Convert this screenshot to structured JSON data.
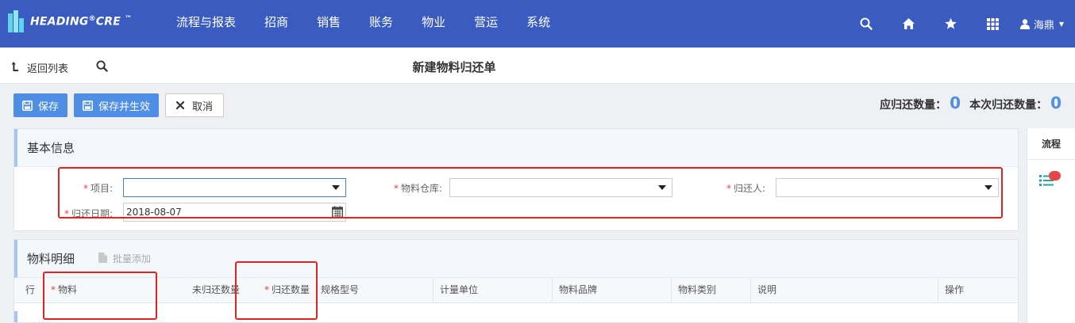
{
  "brand": {
    "name": "HEADING",
    "registered": "®",
    "suffix": "CRE",
    "tm": "™"
  },
  "nav": {
    "items": [
      {
        "label": "流程与报表"
      },
      {
        "label": "招商"
      },
      {
        "label": "销售"
      },
      {
        "label": "账务"
      },
      {
        "label": "物业"
      },
      {
        "label": "营运"
      },
      {
        "label": "系统"
      }
    ]
  },
  "user": {
    "name": "海鼎"
  },
  "subbar": {
    "back_label": "返回列表",
    "title": "新建物料归还单"
  },
  "toolbar": {
    "save_label": "保存",
    "save_activate_label": "保存并生效",
    "cancel_label": "取消"
  },
  "counts": {
    "should_return_label": "应归还数量：",
    "should_return_value": "0",
    "this_return_label": "本次归还数量：",
    "this_return_value": "0"
  },
  "basic": {
    "title": "基本信息",
    "required_mark": "*",
    "project_label": "项目:",
    "warehouse_label": "物料仓库:",
    "returner_label": "归还人:",
    "date_label": "归还日期:",
    "date_value": "2018-08-07"
  },
  "detail": {
    "title": "物料明细",
    "batch_add_label": "批量添加",
    "columns": {
      "row": "行",
      "material": "物料",
      "unreturned": "未归还数量",
      "return_qty": "归还数量",
      "spec": "规格型号",
      "unit": "计量单位",
      "brand": "物料品牌",
      "category": "物料类别",
      "note": "说明",
      "ops": "操作"
    }
  },
  "flow": {
    "tab_label": "流程"
  },
  "colors": {
    "topbar": "#3a5bbf",
    "primary": "#4e8ee5",
    "required": "#e54040",
    "annotation": "#e02424"
  }
}
